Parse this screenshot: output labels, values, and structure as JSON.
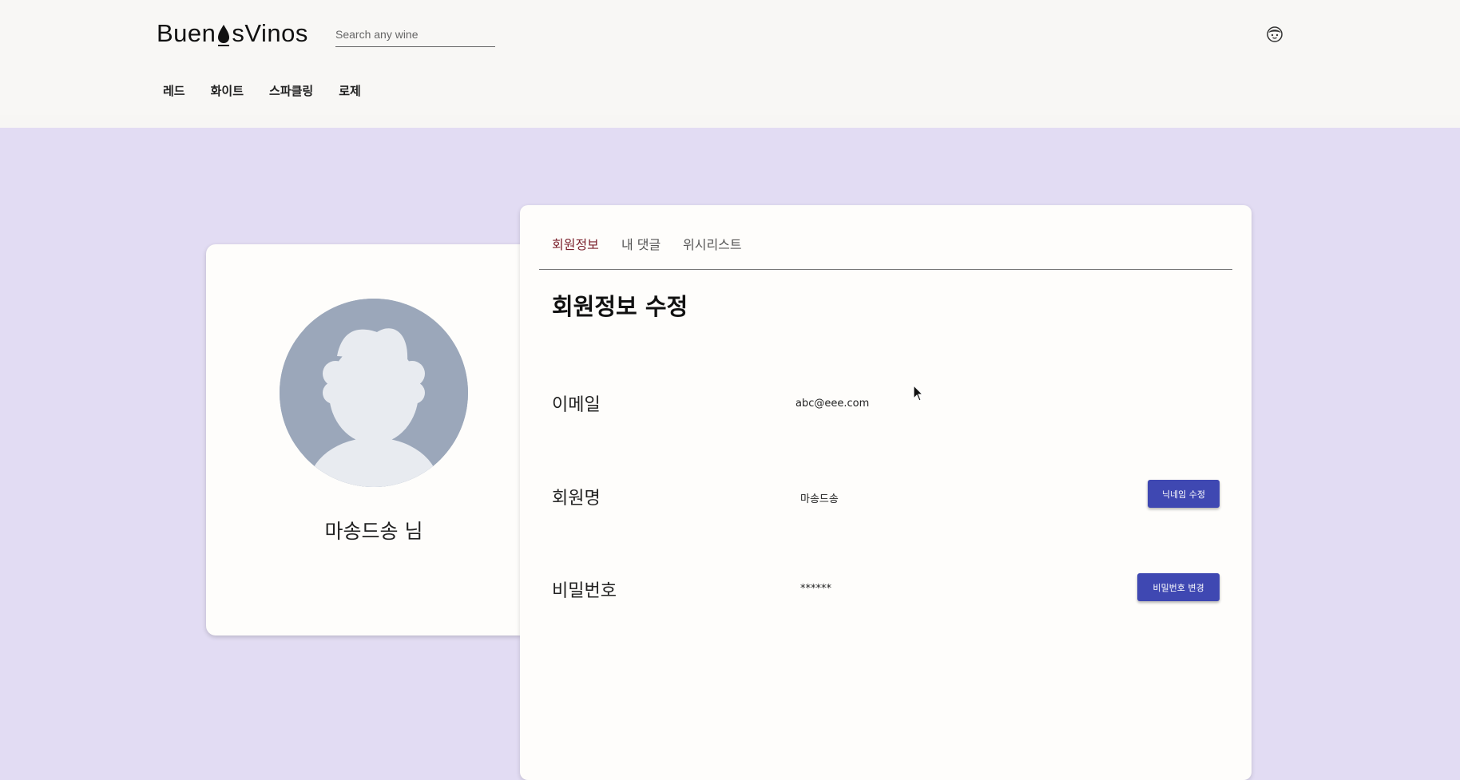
{
  "header": {
    "logo_left": "Buen",
    "logo_right": "sVinos",
    "search_placeholder": "Search any wine",
    "user_icon": "user-face-icon"
  },
  "nav": {
    "items": [
      {
        "label": "레드"
      },
      {
        "label": "화이트"
      },
      {
        "label": "스파클링"
      },
      {
        "label": "로제"
      }
    ]
  },
  "profile": {
    "name": "마송드송 님",
    "avatar_icon": "default-avatar-icon"
  },
  "tabs": [
    {
      "label": "회원정보",
      "active": true
    },
    {
      "label": "내 댓글",
      "active": false
    },
    {
      "label": "위시리스트",
      "active": false
    }
  ],
  "section": {
    "title": "회원정보 수정"
  },
  "rows": {
    "email": {
      "label": "이메일",
      "value": "abc@eee.com"
    },
    "nickname": {
      "label": "회원명",
      "value": "마송드송",
      "button": "닉네임 수정"
    },
    "password": {
      "label": "비밀번호",
      "value": "******",
      "button": "비밀번호 변경"
    }
  },
  "colors": {
    "background": "#e2dcf3",
    "header": "#f8f7f5",
    "accent_button": "#3f48b2",
    "active_tab": "#7a1f2b",
    "avatar_bg": "#9ba7ba"
  }
}
